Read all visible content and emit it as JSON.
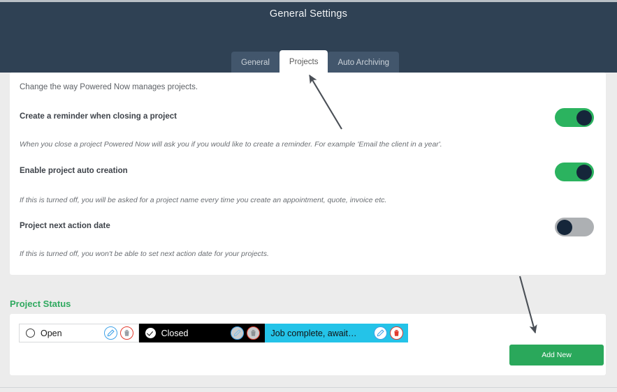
{
  "header": {
    "title": "General Settings"
  },
  "tabs": [
    {
      "label": "General",
      "active": false
    },
    {
      "label": "Projects",
      "active": true
    },
    {
      "label": "Auto Archiving",
      "active": false
    }
  ],
  "main": {
    "intro": "Change the way Powered Now manages projects.",
    "settings": [
      {
        "label": "Create a reminder when closing a project",
        "description": "When you close a project Powered Now will ask you if you would like to create a reminder. For example 'Email the client in a year'.",
        "toggle_state": "on"
      },
      {
        "label": "Enable project auto creation",
        "description": "If this is turned off, you will be asked for a project name every time you create an appointment, quote, invoice etc.",
        "toggle_state": "on"
      },
      {
        "label": "Project next action date",
        "description": "If this is turned off, you won't be able to set next action date for your projects.",
        "toggle_state": "off"
      }
    ]
  },
  "project_status": {
    "heading": "Project Status",
    "chips": [
      {
        "label": "Open",
        "marker": "radio-unchecked-icon",
        "style": "open"
      },
      {
        "label": "Closed",
        "marker": "check-circle-icon",
        "style": "closed"
      },
      {
        "label": "Job complete, await…",
        "marker": "none",
        "style": "cyan"
      }
    ],
    "edit_icon": "pencil-icon",
    "delete_icon": "trash-icon",
    "add_new_label": "Add New"
  },
  "colors": {
    "header_bg": "#2f4154",
    "toggle_on": "#2bb35f",
    "toggle_off": "#adb0b3",
    "toggle_knob": "#15263a",
    "accent_green": "#2fa95f",
    "add_new_bg": "#2aa85b",
    "chip_cyan": "#24c3e8",
    "edit_blue": "#3fa2e8",
    "delete_red": "#e23b2e",
    "page_bg": "#ececec"
  }
}
